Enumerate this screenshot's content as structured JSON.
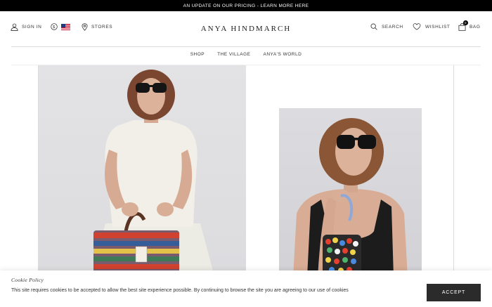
{
  "promo": {
    "text": "AN UPDATE ON OUR PRICING - LEARN MORE HERE"
  },
  "header": {
    "sign_in": "SIGN IN",
    "currency_icon": "dollar-circle-icon",
    "flag": "us-flag",
    "stores": "STORES",
    "logo": "ANYA HINDMARCH",
    "search": "SEARCH",
    "wishlist": "WISHLIST",
    "bag": "BAG",
    "bag_count": "0"
  },
  "nav": {
    "items": [
      "SHOP",
      "THE VILLAGE",
      "ANYA'S WORLD"
    ]
  },
  "cookie": {
    "title": "Cookie Policy",
    "text": "This site requires cookies to be accepted to allow the best site experience possible. By continuing to browse the site you are agreeing to our use of cookies",
    "accept": "ACCEPT"
  },
  "colors": {
    "promo_bg": "#000000",
    "button_bg": "#2b2b2b",
    "divider": "#dddddd"
  }
}
